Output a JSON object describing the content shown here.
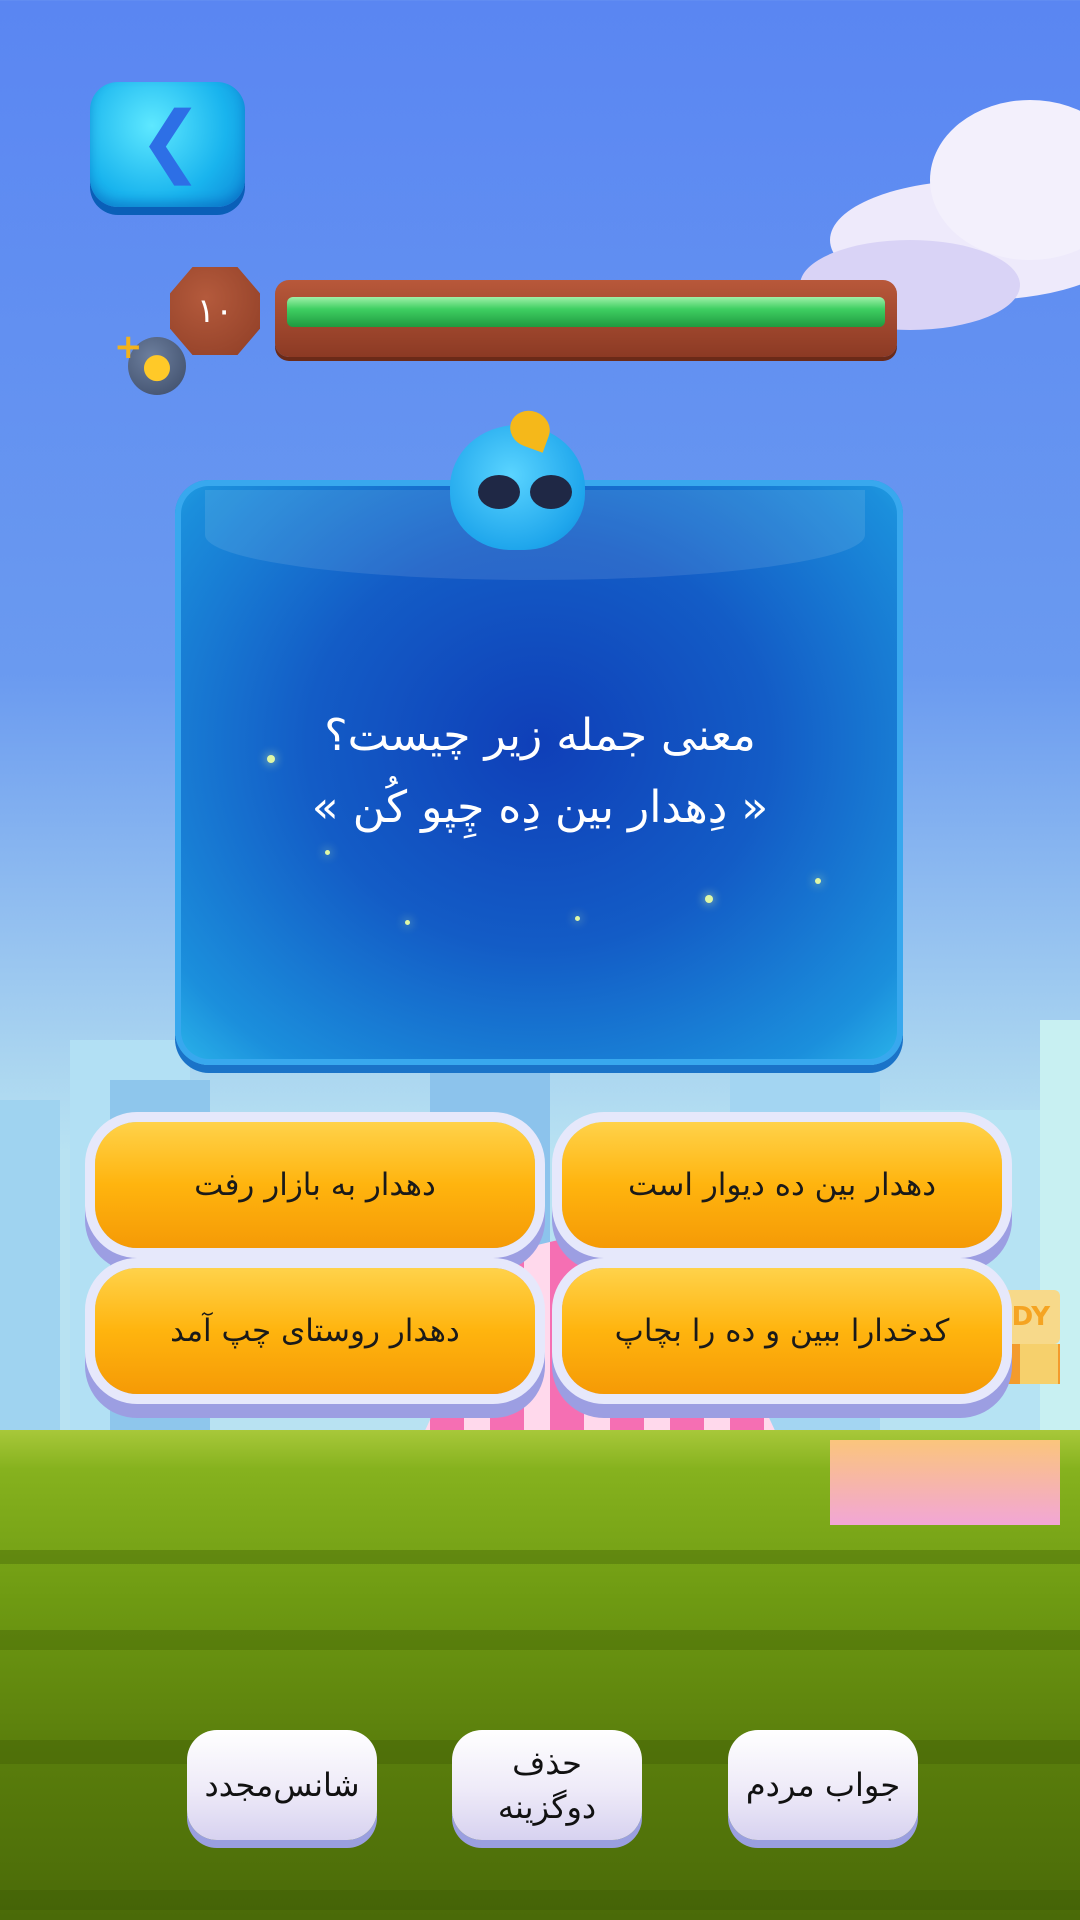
{
  "level": {
    "number": "۱۰"
  },
  "progress": {
    "value": 1.0,
    "color": "#3fcf62"
  },
  "question": {
    "line1": "معنی جمله زیر چیست؟",
    "line2": "« دِهدار بین دِه چِپو کُن »"
  },
  "answers": [
    {
      "text": "دهدار بین ده دیوار است"
    },
    {
      "text": "دهدار به بازار رفت"
    },
    {
      "text": "کدخدارا ببین و ده را بچاپ"
    },
    {
      "text": "دهدار روستای چپ آمد"
    }
  ],
  "helpers": {
    "people_answer": "جواب مردم",
    "remove_two_line1": "حذف",
    "remove_two_line2": "دوگزینه",
    "retry": "شانس‌مجدد"
  },
  "icons": {
    "back": "chevron-left-icon",
    "hint": "lightbulb-icon",
    "plus": "plus-icon"
  },
  "candy_sign": "NDY"
}
